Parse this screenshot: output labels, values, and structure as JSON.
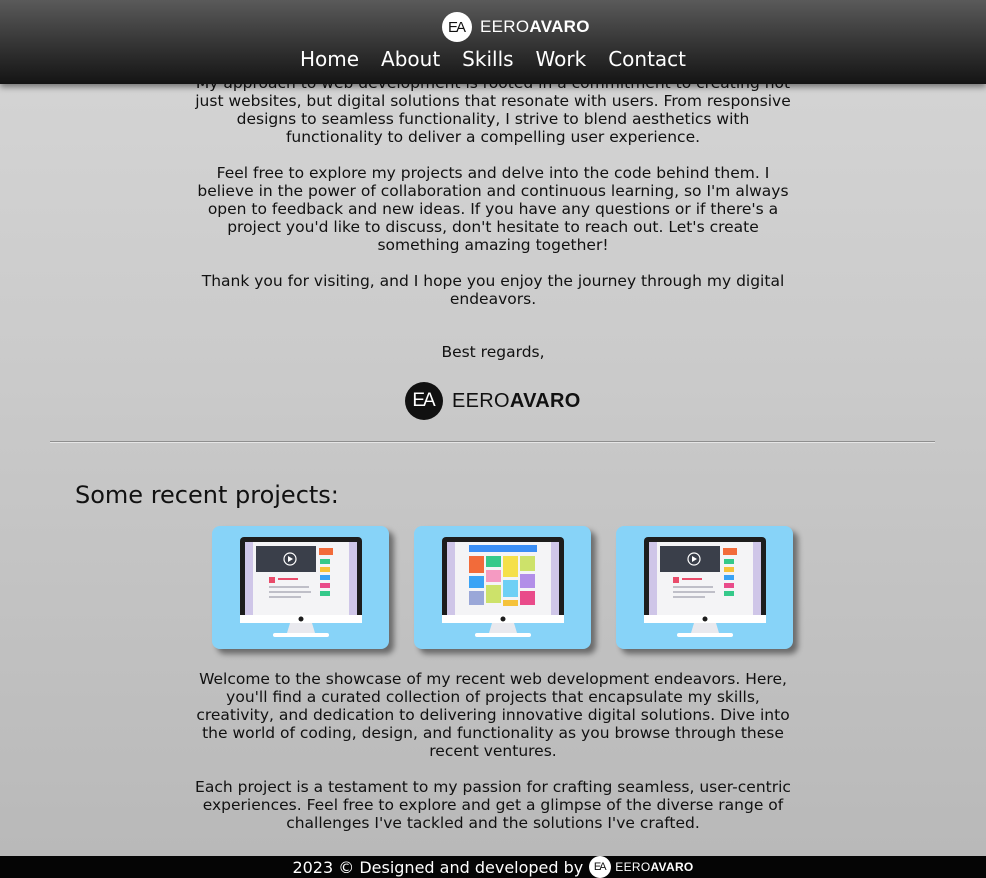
{
  "header": {
    "logo": {
      "initials": "EA",
      "first": "EERO",
      "last": "AVARO"
    },
    "nav": [
      "Home",
      "About",
      "Skills",
      "Work",
      "Contact"
    ]
  },
  "intro": {
    "paragraphs": [
      "My approach to web development is rooted in a commitment to creating not just websites, but digital solutions that resonate with users. From responsive designs to seamless functionality, I strive to blend aesthetics with functionality to deliver a compelling user experience.",
      "Feel free to explore my projects and delve into the code behind them. I believe in the power of collaboration and continuous learning, so I'm always open to feedback and new ideas. If you have any questions or if there's a project you'd like to discuss, don't hesitate to reach out. Let's create something amazing together!",
      "Thank you for visiting, and I hope you enjoy the journey through my digital endeavors."
    ],
    "signoff": "Best regards,"
  },
  "projects": {
    "heading": "Some recent projects:",
    "cards": [
      {
        "illustration": "video-page-monitor-icon"
      },
      {
        "illustration": "tile-grid-monitor-icon"
      },
      {
        "illustration": "video-page-monitor-icon"
      }
    ],
    "description": [
      "Welcome to the showcase of my recent web development endeavors. Here, you'll find a curated collection of projects that encapsulate my skills, creativity, and dedication to delivering innovative digital solutions. Dive into the world of coding, design, and functionality as you browse through these recent ventures.",
      "Each project is a testament to my passion for crafting seamless, user-centric experiences. Feel free to explore and get a glimpse of the diverse range of challenges I've tackled and the solutions I've crafted."
    ]
  },
  "footer": {
    "text": "2023 © Designed and developed by"
  },
  "colors": {
    "card_background": "#87d3f8",
    "header_dark": "#141414",
    "footer": "#050505"
  }
}
